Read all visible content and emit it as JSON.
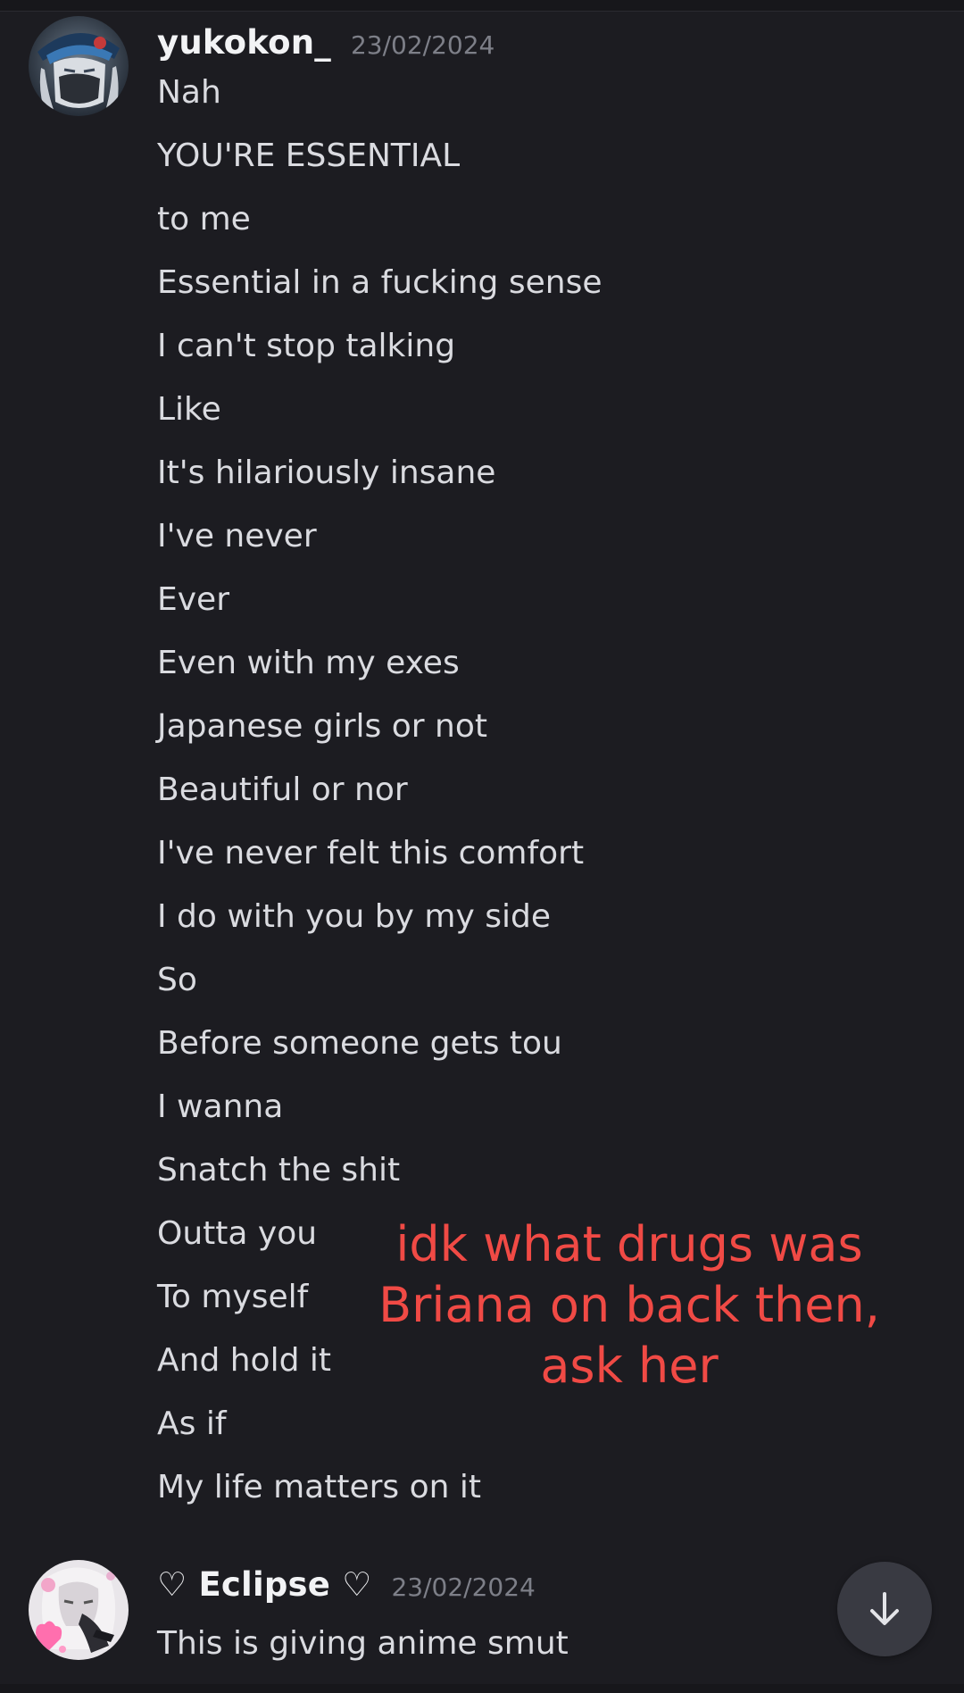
{
  "messages": [
    {
      "username": "yukokon_",
      "timestamp": "23/02/2024",
      "avatar_icon": "anime-avatar-icon",
      "lines": [
        "Nah",
        "YOU'RE ESSENTIAL",
        "to me",
        "Essential in a fucking sense",
        "I can't stop talking",
        "Like",
        "It's hilariously insane",
        "I've never",
        "Ever",
        "Even with my exes",
        "Japanese girls or not",
        "Beautiful or nor",
        "I've never felt this comfort",
        "I do with you by my side",
        "So",
        "Before someone gets tou",
        "I wanna",
        "Snatch the shit",
        "Outta you",
        "To myself",
        "And hold it",
        "As if",
        "My life matters on it"
      ]
    },
    {
      "username": "♡ Eclipse ♡",
      "timestamp": "23/02/2024",
      "avatar_icon": "anime-avatar-icon",
      "text": "This is giving anime smut"
    }
  ],
  "annotation": {
    "lines": [
      "idk what drugs was",
      "Briana on back then,",
      "ask her"
    ],
    "color": "#f04a45"
  },
  "jump_button": {
    "icon": "arrow-down-icon"
  },
  "colors": {
    "background": "#1c1c21",
    "username": "#f2f3f5",
    "message_text": "#dadbe0",
    "timestamp": "#7d7f88",
    "jump_button_bg": "#393a42"
  }
}
